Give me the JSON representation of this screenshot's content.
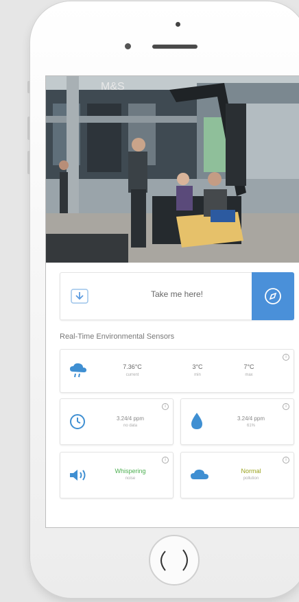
{
  "navigation": {
    "label": "Take me here!",
    "icon": "navigation-arrow-icon",
    "action_icon": "compass-icon"
  },
  "photo": {
    "store_sign": "M&S",
    "description_icon": "bench-photo"
  },
  "sensors": {
    "title": "Real-Time Environmental Sensors",
    "temperature": {
      "icon": "cloud-rain-icon",
      "current_value": "7.36°C",
      "current_caption": "current",
      "min_value": "3°C",
      "min_caption": "min",
      "max_value": "7°C",
      "max_caption": "max"
    },
    "air_quality": {
      "icon": "clock-icon",
      "value": "3.24/4 ppm",
      "caption": "no data"
    },
    "humidity": {
      "icon": "water-drop-icon",
      "value": "3.24/4 ppm",
      "caption": "61%"
    },
    "noise": {
      "icon": "speaker-icon",
      "status": "Whispering",
      "caption": "noise",
      "status_color": "#4caf50"
    },
    "smog": {
      "icon": "cloud-icon",
      "status": "Normal",
      "caption": "pollution",
      "status_color": "#9aa31e"
    }
  },
  "colors": {
    "accent": "#4a90d9",
    "icon_blue": "#3f8fd2"
  }
}
